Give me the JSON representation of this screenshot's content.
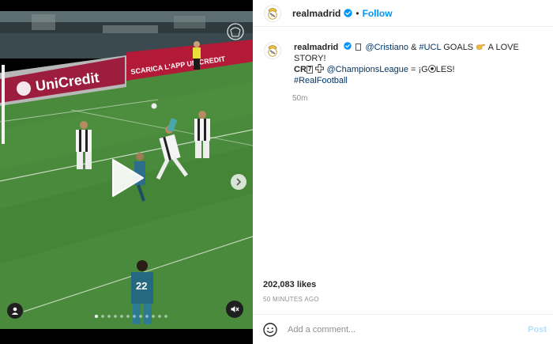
{
  "post": {
    "username": "realmadrid",
    "follow_label": "Follow",
    "separator": "•",
    "caption": {
      "username": "realmadrid",
      "mention_cristiano": "@Cristiano",
      "and": " & ",
      "hashtag_ucl": "#UCL",
      "goals_text": " GOALS ",
      "love_story": " A LOVE STORY!",
      "cr_text": "CR",
      "seven_glyph": "7",
      "mention_ucl": "@ChampionsLeague",
      "equals": " = ¡G",
      "les_text": "LES!",
      "hashtag_football": "#RealFootball"
    },
    "caption_time": "50m",
    "likes": "202,083 likes",
    "time_ago": "50 MINUTES AGO",
    "comment_placeholder": "Add a comment...",
    "post_label": "Post"
  },
  "media": {
    "ad_boards": [
      "UniCredit",
      "SCARICA L'APP UNICREDIT"
    ],
    "player_number": "22",
    "carousel_total": 12,
    "carousel_active": 1
  },
  "colors": {
    "accent": "#0095f6",
    "post_disabled": "#b2dffc",
    "pitch": "#4a8a3c",
    "board": "#9c1d3e"
  },
  "icons": [
    "verified-badge-icon",
    "play-icon",
    "chevron-right-icon",
    "tag-user-icon",
    "mute-icon",
    "emoji-icon",
    "real-madrid-crest-icon",
    "pointing-hand-icon",
    "cross-icon",
    "soccer-ball-icon",
    "missing-glyph-icon"
  ]
}
